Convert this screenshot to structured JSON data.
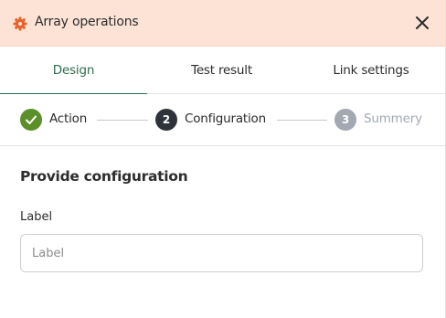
{
  "header": {
    "title": "Array operations",
    "icon": "gear-icon",
    "close_icon": "close-icon",
    "accent_color": "#e8622c",
    "background": "#fce3d6"
  },
  "tabs": [
    {
      "label": "Design",
      "active": true
    },
    {
      "label": "Test result",
      "active": false
    },
    {
      "label": "Link settings",
      "active": false
    }
  ],
  "stepper": {
    "steps": [
      {
        "label": "Action",
        "state": "completed",
        "marker": "",
        "color": "#5b8f29"
      },
      {
        "label": "Configuration",
        "state": "current",
        "marker": "2",
        "color": "#2e333b"
      },
      {
        "label": "Summery",
        "state": "upcoming",
        "marker": "3",
        "color": "#a3a8b3"
      }
    ]
  },
  "form": {
    "section_title": "Provide configuration",
    "fields": [
      {
        "label": "Label",
        "value": "",
        "placeholder": "Label"
      }
    ]
  }
}
